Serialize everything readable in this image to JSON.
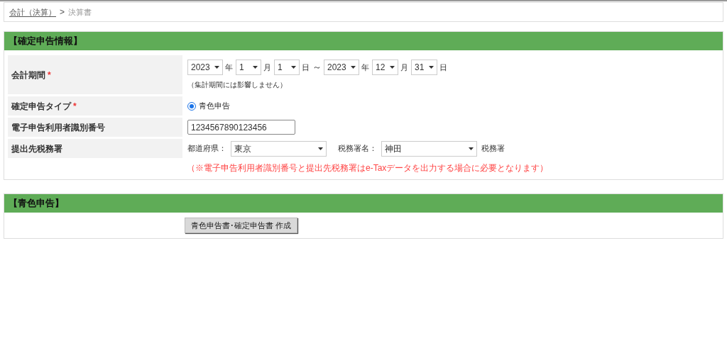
{
  "breadcrumb": {
    "items": [
      {
        "label": "会計（決算）",
        "link": true
      },
      {
        "label": "決算書",
        "link": false
      }
    ],
    "separator": ">"
  },
  "sections": [
    {
      "title": "【確定申告情報】",
      "rows": [
        {
          "kind": "date_range",
          "label": "会計期間",
          "mark": "*",
          "start": [
            {
              "value": "2023",
              "unit": "年"
            },
            {
              "value": "1",
              "unit": "月"
            },
            {
              "value": "1",
              "unit": "日"
            }
          ],
          "separator": "～",
          "end": [
            {
              "value": "2023",
              "unit": "年"
            },
            {
              "value": "12",
              "unit": "月"
            },
            {
              "value": "31",
              "unit": "日"
            }
          ],
          "hint": "（集計期間には影響しません）"
        },
        {
          "kind": "radio",
          "label": "確定申告タイプ",
          "mark": "*",
          "options": [
            {
              "label": "青色申告",
              "selected": true
            }
          ]
        },
        {
          "kind": "text",
          "label": "電子申告利用者識別番号",
          "value": "1234567890123456"
        },
        {
          "kind": "office",
          "label": "提出先税務署",
          "prefecture_label": "都道府県：",
          "prefecture": "東京",
          "office_label": "税務署名：",
          "office": "神田",
          "suffix": "税務署"
        }
      ],
      "note": "（※電子申告利用者識別番号と提出先税務署はe-Taxデータを出力する場合に必要となります）"
    },
    {
      "title": "【青色申告】",
      "button": "青色申告書･確定申告書 作成"
    }
  ]
}
